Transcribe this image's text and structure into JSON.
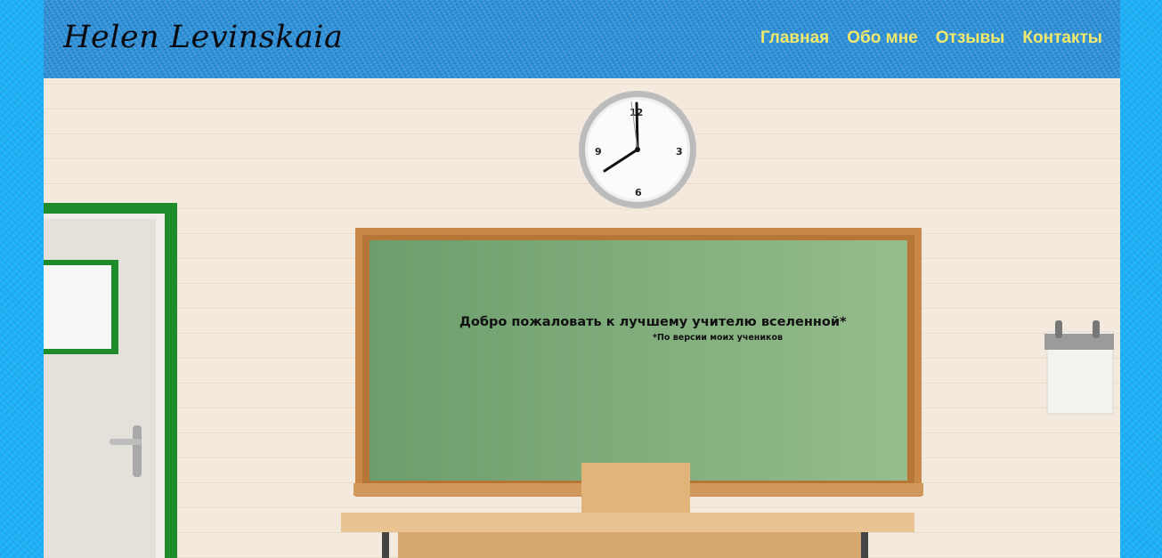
{
  "header": {
    "logo_text": "Helen Levinskaia",
    "nav": [
      {
        "label": "Главная"
      },
      {
        "label": "Обо мне"
      },
      {
        "label": "Отзывы"
      },
      {
        "label": "Контакты"
      }
    ]
  },
  "hero": {
    "welcome_text": "Добро пожаловать к лучшему учителю вселенной*",
    "footnote_text": "*По версии моих учеников",
    "clock_numbers": {
      "twelve": "12",
      "three": "3",
      "six": "6",
      "nine": "9"
    }
  },
  "colors": {
    "page_background": "#1cb0f6",
    "header_background": "#2a8fd6",
    "nav_link": "#f4e96a",
    "chalkboard": "#7fab7c",
    "board_frame": "#c9884a",
    "door_frame": "#1e8c2b"
  }
}
